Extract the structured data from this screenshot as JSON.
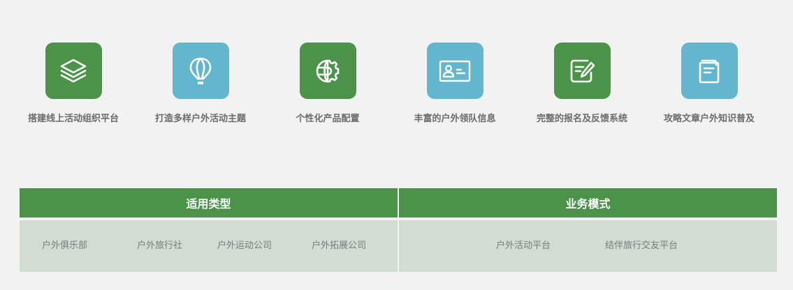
{
  "features": [
    {
      "label": "搭建线上活动组织平台",
      "icon": "layers-icon",
      "color": "#4a9349"
    },
    {
      "label": "打造多样户外活动主题",
      "icon": "hot-air-balloon-icon",
      "color": "#62b7cf"
    },
    {
      "label": "个性化产品配置",
      "icon": "globe-gear-icon",
      "color": "#4a9349"
    },
    {
      "label": "丰富的户外领队信息",
      "icon": "id-card-icon",
      "color": "#62b7cf"
    },
    {
      "label": "完整的报名及反馈系统",
      "icon": "edit-form-icon",
      "color": "#4a9349"
    },
    {
      "label": "攻略文章户外知识普及",
      "icon": "document-icon",
      "color": "#62b7cf"
    }
  ],
  "table": {
    "applicable_types": {
      "title": "适用类型",
      "items": [
        "户外俱乐部",
        "户外旅行社",
        "户外运动公司",
        "户外拓展公司"
      ]
    },
    "business_models": {
      "title": "业务模式",
      "items": [
        "户外活动平台",
        "结伴旅行交友平台"
      ]
    }
  },
  "colors": {
    "green": "#4a9349",
    "blue": "#62b7cf",
    "table_body": "#d1ddd3",
    "page_bg": "#f2f2f2"
  }
}
